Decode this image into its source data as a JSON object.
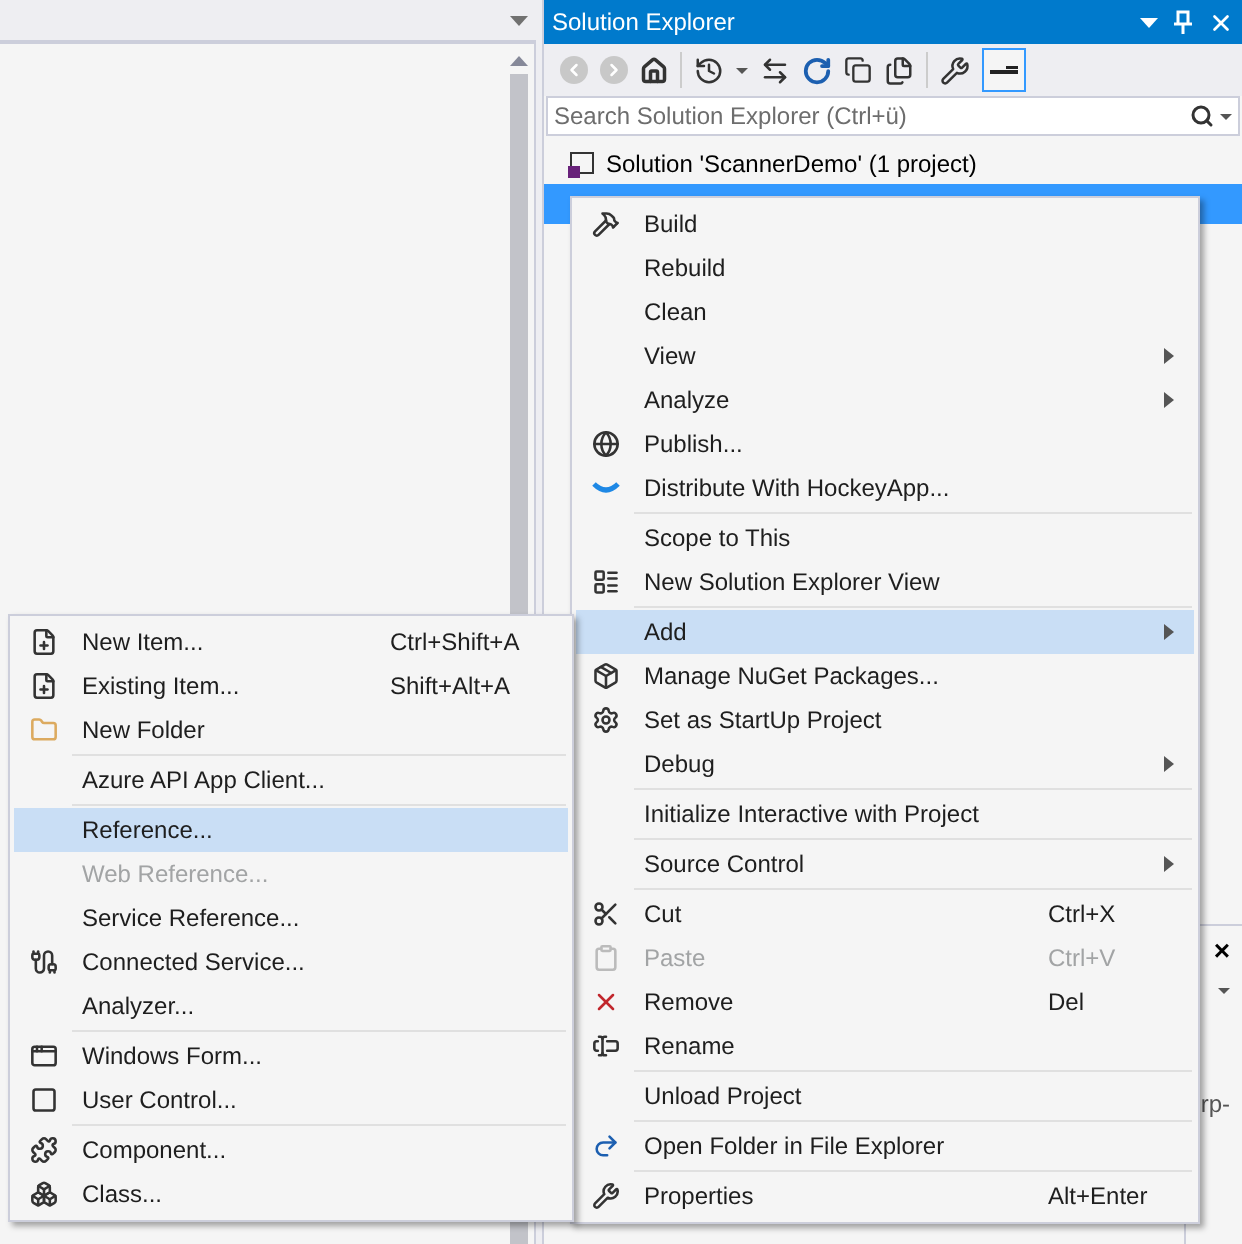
{
  "solution_explorer": {
    "title": "Solution Explorer",
    "search": {
      "placeholder": "Search Solution Explorer (Ctrl+ü)"
    },
    "tree": [
      {
        "label": "Solution 'ScannerDemo' (1 project)",
        "selected": false
      },
      {
        "selected": true
      }
    ]
  },
  "context_menu": [
    {
      "kind": "item",
      "label": "Build",
      "disabled": false,
      "selected": false,
      "submenu": false
    },
    {
      "kind": "item",
      "label": "Rebuild",
      "disabled": false,
      "selected": false,
      "submenu": false
    },
    {
      "kind": "item",
      "label": "Clean",
      "disabled": false,
      "selected": false,
      "submenu": false
    },
    {
      "kind": "item",
      "label": "View",
      "disabled": false,
      "selected": false,
      "submenu": true
    },
    {
      "kind": "item",
      "label": "Analyze",
      "disabled": false,
      "selected": false,
      "submenu": true
    },
    {
      "kind": "item",
      "label": "Publish...",
      "disabled": false,
      "selected": false,
      "submenu": false
    },
    {
      "kind": "item",
      "label": "Distribute With HockeyApp...",
      "disabled": false,
      "selected": false,
      "submenu": false
    },
    {
      "kind": "separator"
    },
    {
      "kind": "item",
      "label": "Scope to This",
      "disabled": false,
      "selected": false,
      "submenu": false
    },
    {
      "kind": "item",
      "label": "New Solution Explorer View",
      "disabled": false,
      "selected": false,
      "submenu": false
    },
    {
      "kind": "separator"
    },
    {
      "kind": "item",
      "label": "Add",
      "disabled": false,
      "selected": true,
      "submenu": true
    },
    {
      "kind": "item",
      "label": "Manage NuGet Packages...",
      "disabled": false,
      "selected": false,
      "submenu": false
    },
    {
      "kind": "item",
      "label": "Set as StartUp Project",
      "disabled": false,
      "selected": false,
      "submenu": false
    },
    {
      "kind": "item",
      "label": "Debug",
      "disabled": false,
      "selected": false,
      "submenu": true
    },
    {
      "kind": "separator"
    },
    {
      "kind": "item",
      "label": "Initialize Interactive with Project",
      "disabled": false,
      "selected": false,
      "submenu": false
    },
    {
      "kind": "separator"
    },
    {
      "kind": "item",
      "label": "Source Control",
      "disabled": false,
      "selected": false,
      "submenu": true
    },
    {
      "kind": "separator"
    },
    {
      "kind": "item",
      "label": "Cut",
      "shortcut": "Ctrl+X",
      "disabled": false,
      "selected": false,
      "submenu": false
    },
    {
      "kind": "item",
      "label": "Paste",
      "shortcut": "Ctrl+V",
      "disabled": true,
      "selected": false,
      "submenu": false
    },
    {
      "kind": "item",
      "label": "Remove",
      "shortcut": "Del",
      "disabled": false,
      "selected": false,
      "submenu": false
    },
    {
      "kind": "item",
      "label": "Rename",
      "disabled": false,
      "selected": false,
      "submenu": false
    },
    {
      "kind": "separator"
    },
    {
      "kind": "item",
      "label": "Unload Project",
      "disabled": false,
      "selected": false,
      "submenu": false
    },
    {
      "kind": "separator"
    },
    {
      "kind": "item",
      "label": "Open Folder in File Explorer",
      "disabled": false,
      "selected": false,
      "submenu": false
    },
    {
      "kind": "separator"
    },
    {
      "kind": "item",
      "label": "Properties",
      "shortcut": "Alt+Enter",
      "disabled": false,
      "selected": false,
      "submenu": false
    }
  ],
  "add_submenu": [
    {
      "kind": "item",
      "label": "New Item...",
      "shortcut": "Ctrl+Shift+A",
      "disabled": false,
      "selected": false
    },
    {
      "kind": "item",
      "label": "Existing Item...",
      "shortcut": "Shift+Alt+A",
      "disabled": false,
      "selected": false
    },
    {
      "kind": "item",
      "label": "New Folder",
      "disabled": false,
      "selected": false
    },
    {
      "kind": "separator"
    },
    {
      "kind": "item",
      "label": "Azure API App Client...",
      "disabled": false,
      "selected": false
    },
    {
      "kind": "separator"
    },
    {
      "kind": "item",
      "label": "Reference...",
      "disabled": false,
      "selected": true
    },
    {
      "kind": "item",
      "label": "Web Reference...",
      "disabled": true,
      "selected": false
    },
    {
      "kind": "item",
      "label": "Service Reference...",
      "disabled": false,
      "selected": false
    },
    {
      "kind": "item",
      "label": "Connected Service...",
      "disabled": false,
      "selected": false
    },
    {
      "kind": "item",
      "label": "Analyzer...",
      "disabled": false,
      "selected": false
    },
    {
      "kind": "separator"
    },
    {
      "kind": "item",
      "label": "Windows Form...",
      "disabled": false,
      "selected": false
    },
    {
      "kind": "item",
      "label": "User Control...",
      "disabled": false,
      "selected": false
    },
    {
      "kind": "separator"
    },
    {
      "kind": "item",
      "label": "Component...",
      "disabled": false,
      "selected": false
    },
    {
      "kind": "item",
      "label": "Class...",
      "disabled": false,
      "selected": false
    }
  ],
  "lower_panel": {
    "close": "×",
    "text": "rp-"
  }
}
